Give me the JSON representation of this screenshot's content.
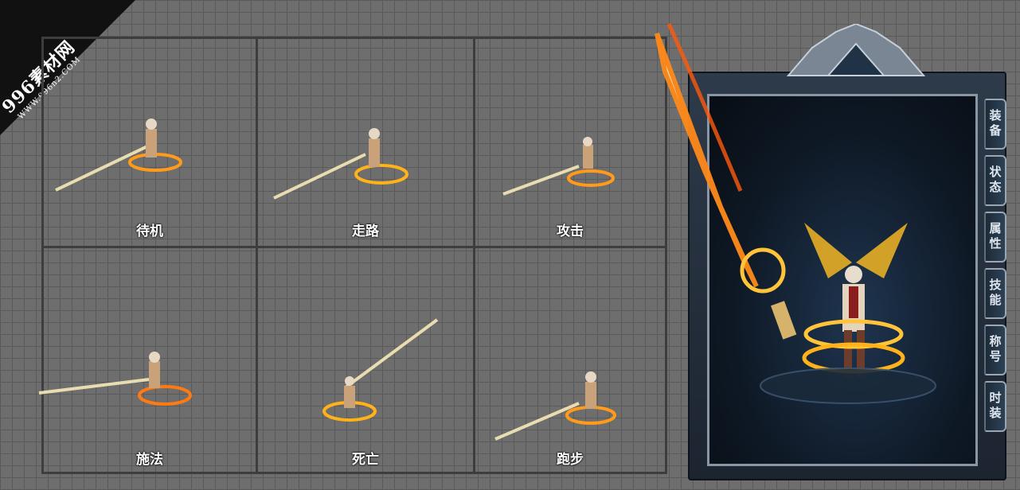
{
  "watermark": {
    "main": "996素材网",
    "sub": "WWW.996n2.COM"
  },
  "actions": [
    {
      "label": "待机"
    },
    {
      "label": "走路"
    },
    {
      "label": "攻击"
    },
    {
      "label": "施法"
    },
    {
      "label": "死亡"
    },
    {
      "label": "跑步"
    }
  ],
  "panel": {
    "tabs": [
      {
        "label": "装备"
      },
      {
        "label": "状态"
      },
      {
        "label": "属性"
      },
      {
        "label": "技能"
      },
      {
        "label": "称号"
      },
      {
        "label": "时装"
      }
    ]
  },
  "colors": {
    "grid_bg": "#6e6e6e",
    "grid_line": "#5a5a5a",
    "fire": "#ff8a1a",
    "gold": "#ffc43a"
  }
}
